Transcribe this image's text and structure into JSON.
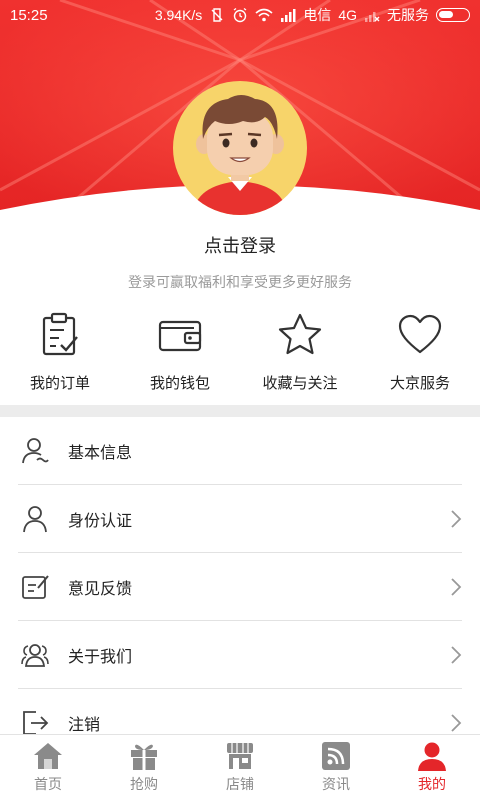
{
  "status_bar": {
    "time": "15:25",
    "speed": "3.94K/s",
    "carrier": "电信",
    "network": "4G",
    "no_service": "无服务"
  },
  "colors": {
    "brand_red": "#e4262a",
    "text": "#222222",
    "muted": "#9a9a9a",
    "icon_gray": "#8a8a8a"
  },
  "profile": {
    "login_label": "点击登录",
    "login_hint": "登录可赢取福利和享受更多更好服务"
  },
  "quick_actions": [
    {
      "icon": "clipboard-check-icon",
      "label": "我的订单"
    },
    {
      "icon": "wallet-icon",
      "label": "我的钱包"
    },
    {
      "icon": "star-icon",
      "label": "收藏与关注"
    },
    {
      "icon": "heart-icon",
      "label": "大京服务"
    }
  ],
  "menu": [
    {
      "icon": "user-info-icon",
      "label": "基本信息"
    },
    {
      "icon": "user-icon",
      "label": "身份认证"
    },
    {
      "icon": "feedback-icon",
      "label": "意见反馈"
    },
    {
      "icon": "group-icon",
      "label": "关于我们"
    },
    {
      "icon": "logout-icon",
      "label": "注销"
    }
  ],
  "tabbar": {
    "active": "我的",
    "tabs": [
      {
        "icon": "home-icon",
        "label": "首页"
      },
      {
        "icon": "gift-icon",
        "label": "抢购"
      },
      {
        "icon": "store-icon",
        "label": "店铺"
      },
      {
        "icon": "news-icon",
        "label": "资讯"
      },
      {
        "icon": "profile-icon",
        "label": "我的"
      }
    ]
  }
}
